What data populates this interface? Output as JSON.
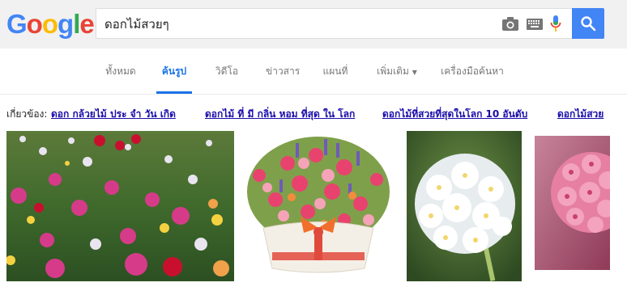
{
  "header": {
    "logo_letters": [
      "G",
      "o",
      "o",
      "g",
      "l",
      "e"
    ],
    "logo_colors": [
      "#4285f4",
      "#ea4335",
      "#fbbc05",
      "#4285f4",
      "#34a853",
      "#ea4335"
    ],
    "search_value": "ดอกไม้สวยๆ",
    "icons": [
      "camera-icon",
      "keyboard-icon",
      "microphone-icon",
      "search-icon"
    ],
    "accent": "#4285f4"
  },
  "tabs": [
    {
      "label": "ทั้งหมด",
      "active": false
    },
    {
      "label": "ค้นรูป",
      "active": true
    },
    {
      "label": "วิดีโอ",
      "active": false
    },
    {
      "label": "ข่าวสาร",
      "active": false
    },
    {
      "label": "แผนที่",
      "active": false
    },
    {
      "label": "เพิ่มเติม",
      "active": false
    },
    {
      "label": "เครื่องมือค้นหา",
      "active": false
    }
  ],
  "related": {
    "label": "เกี่ยวข้อง:",
    "links": [
      "ดอก กล้วยไม้ ประ จํา วัน เกิด",
      "ดอกไม้ ที่ มี กลิ่น หอม ที่สุด ใน โลก",
      "ดอกไม้ที่สวยที่สุดในโลก 10 อันดับ",
      "ดอกไม้สวย"
    ]
  },
  "images": [
    {
      "name": "flower-field-image"
    },
    {
      "name": "flower-basket-image"
    },
    {
      "name": "white-flower-image"
    },
    {
      "name": "pink-flower-image"
    }
  ]
}
